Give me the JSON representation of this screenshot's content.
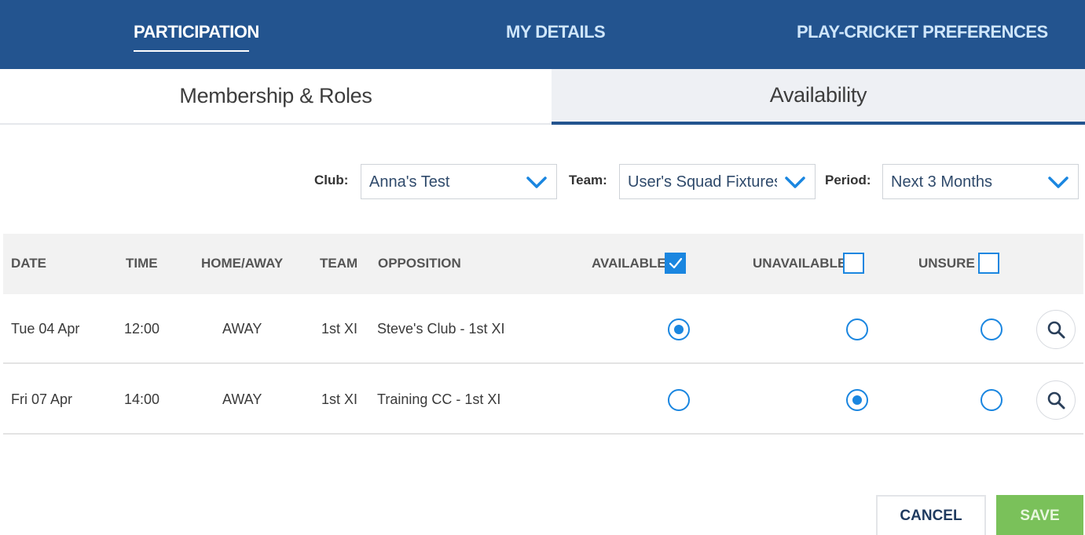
{
  "nav": {
    "items": [
      {
        "label": "PARTICIPATION",
        "active": true
      },
      {
        "label": "MY DETAILS",
        "active": false
      },
      {
        "label": "PLAY-CRICKET PREFERENCES",
        "active": false
      }
    ]
  },
  "subtabs": [
    {
      "label": "Membership & Roles",
      "active": false
    },
    {
      "label": "Availability",
      "active": true
    }
  ],
  "filters": {
    "club": {
      "label": "Club:",
      "value": "Anna's Test"
    },
    "team": {
      "label": "Team:",
      "value": "User's Squad Fixtures"
    },
    "period": {
      "label": "Period:",
      "value": "Next 3 Months"
    }
  },
  "table": {
    "headers": {
      "date": "DATE",
      "time": "TIME",
      "home_away": "HOME/AWAY",
      "team": "TEAM",
      "opposition": "OPPOSITION",
      "available": "AVAILABLE",
      "unavailable": "UNAVAILABLE",
      "unsure": "UNSURE"
    },
    "header_checks": {
      "available": true,
      "unavailable": false,
      "unsure": false
    },
    "rows": [
      {
        "date": "Tue 04 Apr",
        "time": "12:00",
        "home_away": "AWAY",
        "team": "1st XI",
        "opposition": "Steve's Club - 1st XI",
        "selected": "available"
      },
      {
        "date": "Fri 07 Apr",
        "time": "14:00",
        "home_away": "AWAY",
        "team": "1st XI",
        "opposition": "Training CC - 1st XI",
        "selected": "unavailable"
      }
    ]
  },
  "actions": {
    "cancel_label": "CANCEL",
    "save_label": "SAVE"
  },
  "colors": {
    "nav_bg": "#23548f",
    "accent": "#1a86e0",
    "save": "#7ac15a"
  },
  "icons": {
    "dropdown": "chevron-down-icon",
    "details": "search-icon",
    "check": "checkmark-icon"
  }
}
